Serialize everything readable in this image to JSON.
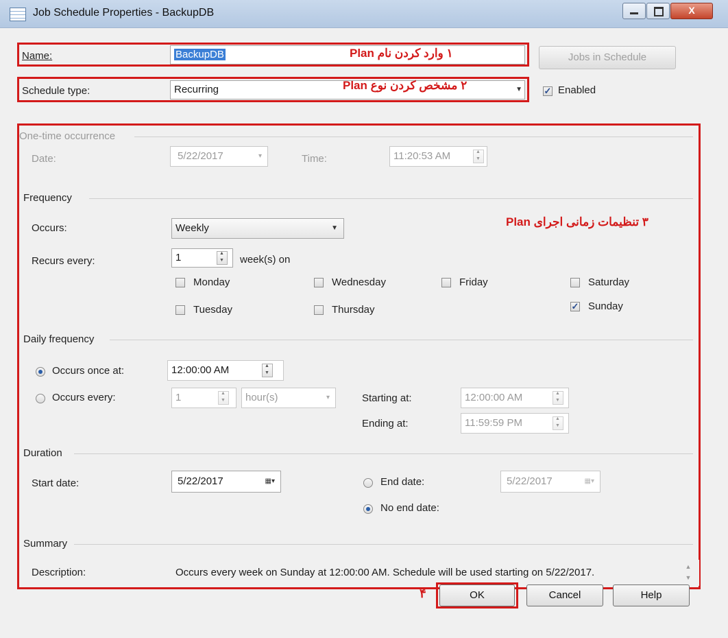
{
  "window": {
    "title": "Job Schedule Properties - BackupDB",
    "close_glyph": "X"
  },
  "name": {
    "label": "Name:",
    "value": "BackupDB",
    "annotation": "۱  وارد کردن نام Plan"
  },
  "jobs_button": "Jobs in Schedule",
  "schedule_type": {
    "label": "Schedule type:",
    "value": "Recurring",
    "annotation": "۲  مشخص کردن نوع Plan"
  },
  "enabled": {
    "label": "Enabled",
    "checked": true
  },
  "one_time": {
    "header": "One-time occurrence",
    "date_label": "Date:",
    "date_value": "5/22/2017",
    "time_label": "Time:",
    "time_value": "11:20:53 AM"
  },
  "frequency": {
    "header": "Frequency",
    "annotation": "۳  تنظیمات زمانی اجرای Plan",
    "occurs_label": "Occurs:",
    "occurs_value": "Weekly",
    "recurs_label": "Recurs every:",
    "recurs_value": "1",
    "recurs_unit": "week(s) on",
    "days": [
      {
        "label": "Monday",
        "checked": false
      },
      {
        "label": "Wednesday",
        "checked": false
      },
      {
        "label": "Friday",
        "checked": false
      },
      {
        "label": "Saturday",
        "checked": false
      },
      {
        "label": "Tuesday",
        "checked": false
      },
      {
        "label": "Thursday",
        "checked": false
      },
      {
        "label": "Sunday",
        "checked": true
      }
    ]
  },
  "daily": {
    "header": "Daily frequency",
    "once_label": "Occurs once at:",
    "once_value": "12:00:00 AM",
    "every_label": "Occurs every:",
    "every_value": "1",
    "every_unit": "hour(s)",
    "starting_label": "Starting at:",
    "starting_value": "12:00:00 AM",
    "ending_label": "Ending at:",
    "ending_value": "11:59:59 PM"
  },
  "duration": {
    "header": "Duration",
    "start_label": "Start date:",
    "start_value": "5/22/2017",
    "end_label": "End date:",
    "end_value": "5/22/2017",
    "no_end_label": "No end date:"
  },
  "summary": {
    "header": "Summary",
    "desc_label": "Description:",
    "desc_value": "Occurs every week on Sunday at 12:00:00 AM. Schedule will be used starting on 5/22/2017."
  },
  "buttons": {
    "step_number": "۴",
    "ok": "OK",
    "cancel": "Cancel",
    "help": "Help"
  },
  "colors": {
    "annotation_red": "#d31a1a",
    "selection_blue": "#3b7fd6",
    "dialog_bg": "#f0f0f0"
  }
}
